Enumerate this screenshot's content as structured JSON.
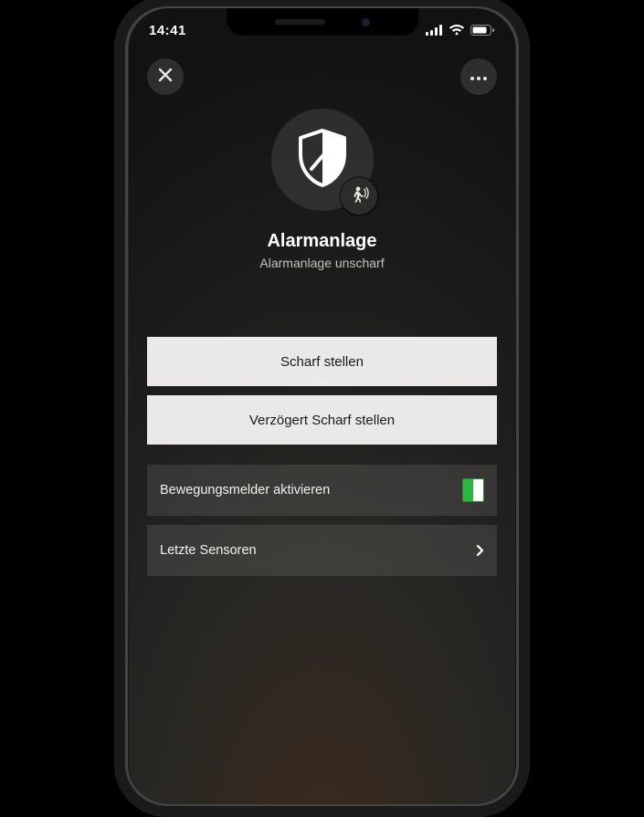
{
  "status_bar": {
    "time": "14:41"
  },
  "header": {
    "close_icon": "close",
    "more_icon": "more"
  },
  "hero": {
    "title": "Alarmanlage",
    "subtitle": "Alarmanlage unscharf",
    "icon": "shield",
    "badge_icon": "motion"
  },
  "actions": {
    "arm": "Scharf stellen",
    "arm_delayed": "Verzögert Scharf stellen"
  },
  "rows": {
    "motion_toggle_label": "Bewegungsmelder aktivieren",
    "motion_toggle_on": true,
    "last_sensors_label": "Letzte Sensoren"
  },
  "colors": {
    "toggle_on": "#2fb642"
  }
}
